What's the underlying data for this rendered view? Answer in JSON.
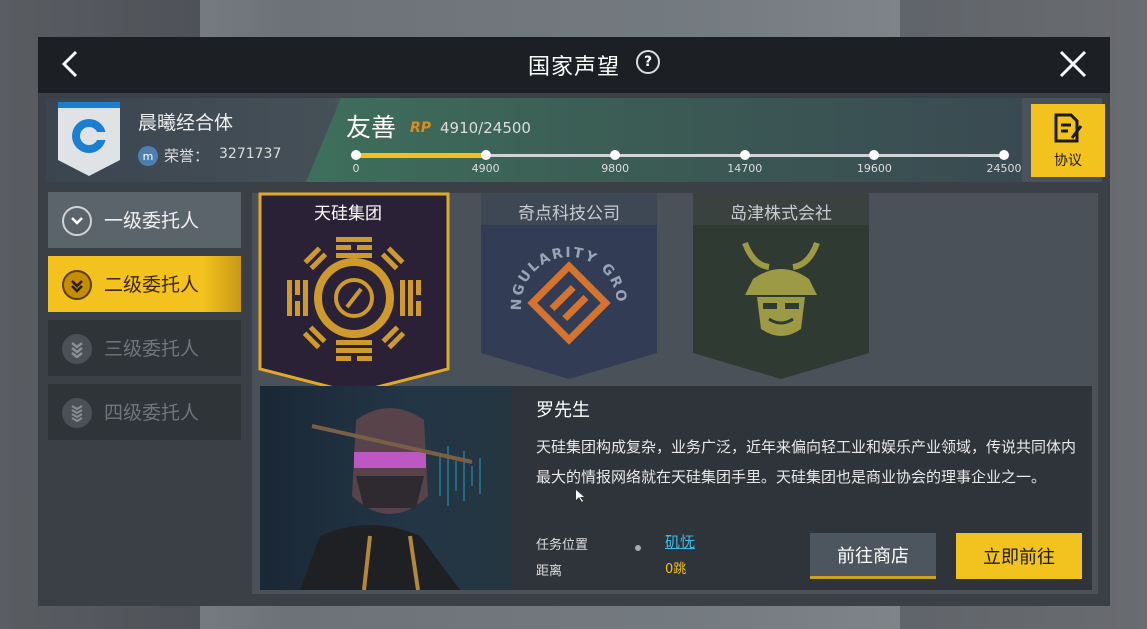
{
  "header": {
    "title": "国家声望",
    "help": "?"
  },
  "faction": {
    "name": "晨曦经合体",
    "honor_icon": "m",
    "honor_label": "荣誉：",
    "honor_value": "3271737",
    "level": "友善",
    "rp_label": "RP",
    "rp_value": "4910/24500",
    "progress_fraction": 0.2004,
    "ticks": [
      "0",
      "4900",
      "9800",
      "14700",
      "19600",
      "24500"
    ],
    "protocol_label": "协议"
  },
  "sidebar": {
    "items": [
      {
        "label": "一级委托人",
        "state": "normal"
      },
      {
        "label": "二级委托人",
        "state": "active"
      },
      {
        "label": "三级委托人",
        "state": "locked"
      },
      {
        "label": "四级委托人",
        "state": "locked"
      }
    ]
  },
  "companies": [
    {
      "name": "天硅集团",
      "selected": true
    },
    {
      "name": "奇点科技公司",
      "logo_text": "SINGULARITY GROUP",
      "selected": false
    },
    {
      "name": "岛津株式会社",
      "selected": false
    }
  ],
  "contact": {
    "name": "罗先生",
    "description": "天硅集团构成复杂，业务广泛，近年来偏向轻工业和娱乐产业领域，传说共同体内最大的情报网络就在天硅集团手里。天硅集团也是商业协会的理事企业之一。",
    "location_label": "任务位置",
    "location_value": "矶怃",
    "distance_label": "距离",
    "distance_value": "0跳"
  },
  "buttons": {
    "shop": "前往商店",
    "go": "立即前往"
  },
  "colors": {
    "accent": "#f2c31f",
    "link": "#3fb8e9",
    "rp": "#e08a1e"
  }
}
